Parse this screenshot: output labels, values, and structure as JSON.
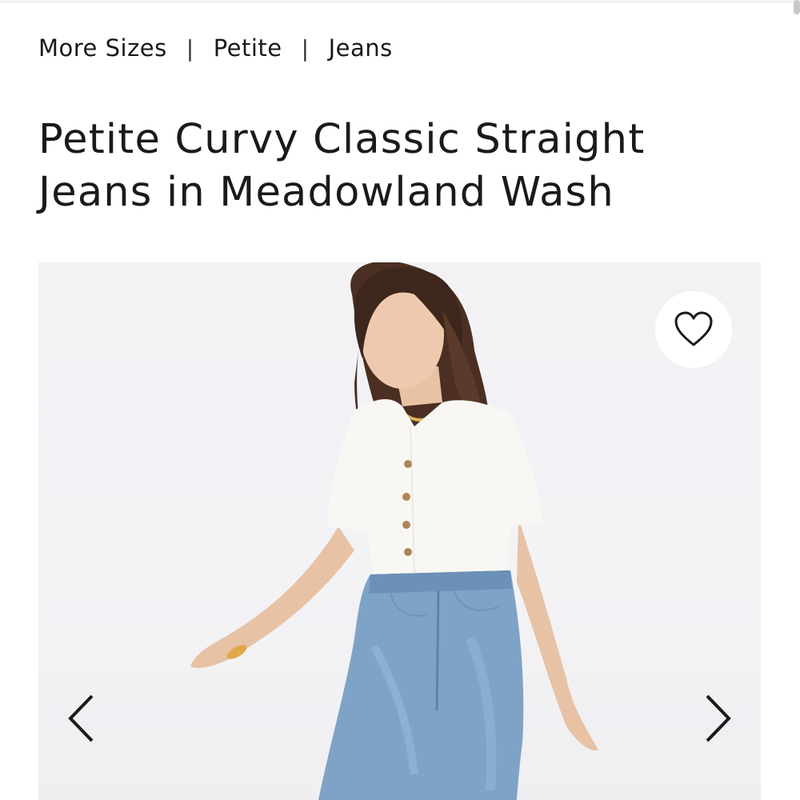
{
  "breadcrumb": {
    "items": [
      {
        "label": "More Sizes"
      },
      {
        "label": "Petite"
      },
      {
        "label": "Jeans"
      }
    ],
    "separator": "|"
  },
  "product": {
    "title": "Petite Curvy Classic Straight Jeans in Meadowland Wash"
  },
  "gallery": {
    "image_alt": "Model wearing white short-sleeve button top and light wash straight jeans",
    "favorite_icon": "heart-outline-icon",
    "prev_icon": "chevron-left-icon",
    "next_icon": "chevron-right-icon"
  },
  "colors": {
    "text": "#1a1a1a",
    "gallery_bg": "#f2f2f5",
    "denim": "#7fa3c7",
    "top": "#f8f7f3"
  }
}
